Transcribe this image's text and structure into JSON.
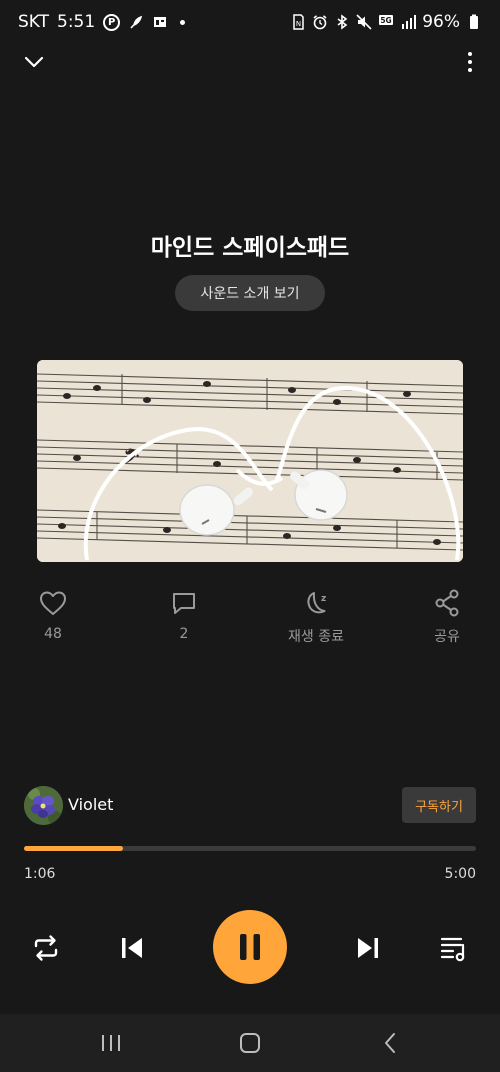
{
  "status_bar": {
    "carrier": "SKT",
    "time": "5:51",
    "network": "5G",
    "battery": "96%"
  },
  "sound": {
    "title": "마인드 스페이스패드",
    "intro_button": "사운드 소개 보기"
  },
  "actions": {
    "like_count": "48",
    "comment_count": "2",
    "sleep_timer_label": "재생 종료",
    "share_label": "공유"
  },
  "creator": {
    "name": "Violet",
    "subscribe_label": "구독하기"
  },
  "player": {
    "current_time": "1:06",
    "total_time": "5:00",
    "progress_fraction": 0.22
  },
  "colors": {
    "background": "#181818",
    "accent": "#ffa53a",
    "secondary_text": "#9a9a9a",
    "chip_background": "#3a3a3a"
  },
  "icons": {
    "collapse": "chevron-down-icon",
    "more": "more-vertical-icon",
    "like": "heart-icon",
    "comment": "comment-icon",
    "sleep": "moon-zz-icon",
    "share": "share-icon",
    "repeat": "repeat-icon",
    "previous": "skip-previous-icon",
    "pause": "pause-icon",
    "next": "skip-next-icon",
    "playlist": "playlist-icon"
  }
}
